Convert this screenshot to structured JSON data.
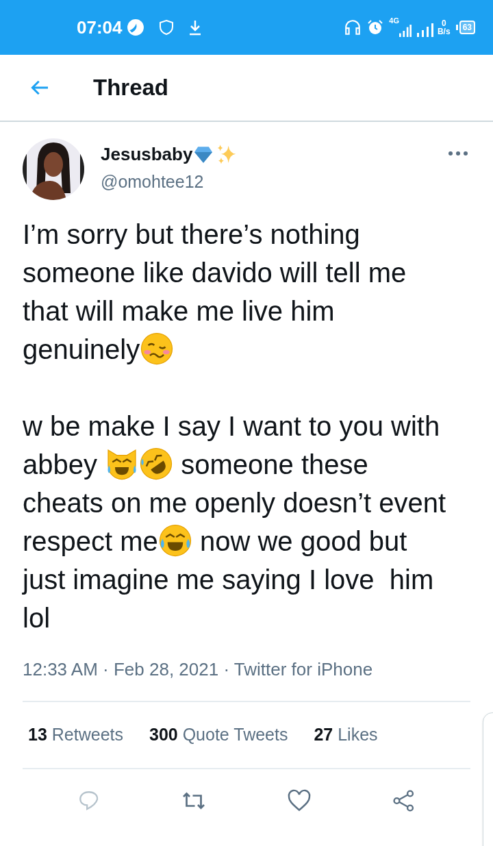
{
  "status_bar": {
    "time": "07:04",
    "network": "4G",
    "speed_value": "0",
    "speed_unit": "B/s",
    "battery": "63"
  },
  "header": {
    "title": "Thread"
  },
  "tweet": {
    "author": {
      "name": "Jesusbaby",
      "handle": "@omohtee12"
    },
    "paragraphs": [
      [
        [
          {
            "kind": "text",
            "text": "I’m sorry but there’s nothing"
          }
        ],
        [
          {
            "kind": "text",
            "text": "someone like davido will tell me"
          }
        ],
        [
          {
            "kind": "text",
            "text": "that will make me live him"
          }
        ],
        [
          {
            "kind": "text",
            "text": "genuinely"
          },
          {
            "kind": "woozy"
          }
        ]
      ],
      [
        [
          {
            "kind": "text",
            "text": "w be make I say I want to you with"
          }
        ],
        [
          {
            "kind": "text",
            "text": "abbey "
          },
          {
            "kind": "catjoy"
          },
          {
            "kind": "rofl"
          },
          {
            "kind": "text",
            "text": " someone these"
          }
        ],
        [
          {
            "kind": "text",
            "text": "cheats on me openly doesn’t event"
          }
        ],
        [
          {
            "kind": "text",
            "text": "respect me"
          },
          {
            "kind": "joy"
          },
          {
            "kind": "text",
            "text": " now we good but"
          }
        ],
        [
          {
            "kind": "text",
            "text": "just imagine me saying I love  him"
          }
        ],
        [
          {
            "kind": "text",
            "text": "lol"
          }
        ]
      ]
    ],
    "meta": "12:33 AM · Feb 28, 2021 · Twitter for iPhone",
    "stats": [
      {
        "count": "13",
        "label": "Retweets"
      },
      {
        "count": "300",
        "label": "Quote Tweets"
      },
      {
        "count": "27",
        "label": "Likes"
      }
    ]
  }
}
